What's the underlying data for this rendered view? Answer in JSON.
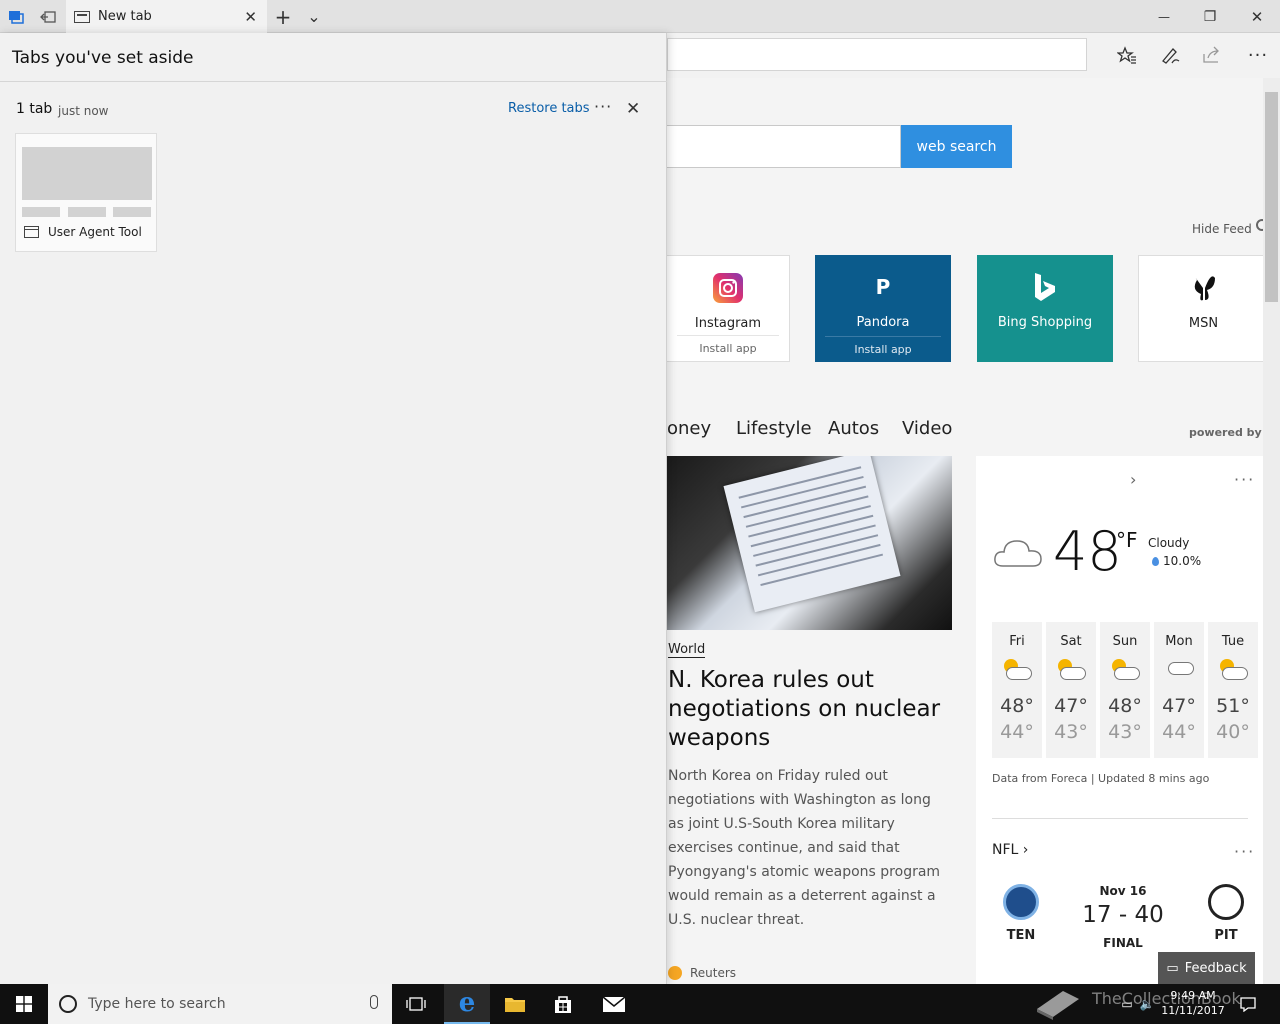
{
  "browser": {
    "tab": {
      "title": "New tab"
    },
    "buttons": {
      "new_tab": "+",
      "tab_list": "⌄",
      "minimize": "—",
      "maximize": "❐",
      "close": "✕"
    },
    "toolbar_icons": [
      "favorites-icon",
      "pen-icon",
      "share-icon",
      "more-icon"
    ]
  },
  "flyout": {
    "title": "Tabs you've set aside",
    "group": {
      "count": "1 tab",
      "time": "just now",
      "restore_label": "Restore tabs",
      "more": "···",
      "close": "✕",
      "tabs": [
        {
          "title": "User Agent Tool"
        }
      ]
    }
  },
  "page": {
    "search_button": "web search",
    "hide_feed": "Hide Feed",
    "tiles": [
      {
        "name": "Instagram",
        "install": "Install app",
        "bg": "#ffffff",
        "fg": "#222222"
      },
      {
        "name": "Pandora",
        "logo": "P",
        "install": "Install app",
        "bg": "#0b5b8c",
        "fg": "#ffffff"
      },
      {
        "name": "Bing Shopping",
        "bg": "#15918e",
        "fg": "#ffffff"
      },
      {
        "name": "MSN",
        "bg": "#ffffff",
        "fg": "#222222"
      }
    ],
    "categories": [
      "oney",
      "Lifestyle",
      "Autos",
      "Video"
    ],
    "powered_by": "powered by MS",
    "news": {
      "category": "World",
      "title": "N. Korea rules out negotiations on nuclear weapons",
      "body": "North Korea on Friday ruled out negotiations with Washington as long as joint U.S-South Korea military exercises continue, and said that Pyongyang's atomic weapons program would remain as a deterrent against a U.S. nuclear threat.",
      "source": "Reuters"
    },
    "weather": {
      "temp": "48",
      "unit": "°F",
      "condition": "Cloudy",
      "precip": "10.0%",
      "forecast": [
        {
          "day": "Fri",
          "hi": "48°",
          "lo": "44°"
        },
        {
          "day": "Sat",
          "hi": "47°",
          "lo": "43°"
        },
        {
          "day": "Sun",
          "hi": "48°",
          "lo": "43°"
        },
        {
          "day": "Mon",
          "hi": "47°",
          "lo": "44°"
        },
        {
          "day": "Tue",
          "hi": "51°",
          "lo": "40°"
        }
      ],
      "source": "Data from Foreca | Updated 8 mins ago"
    },
    "nfl": {
      "label": "NFL",
      "date": "Nov 16",
      "score": "17 - 40",
      "status": "FINAL",
      "home": {
        "abbr": "TEN",
        "color": "#1f4e8c"
      },
      "away": {
        "abbr": "PIT",
        "color": "#ffb612"
      }
    },
    "feedback": "Feedback"
  },
  "taskbar": {
    "search_placeholder": "Type here to search",
    "time": "9:49 AM",
    "date": "11/11/2017",
    "watermark": "TheCollectionBook"
  }
}
